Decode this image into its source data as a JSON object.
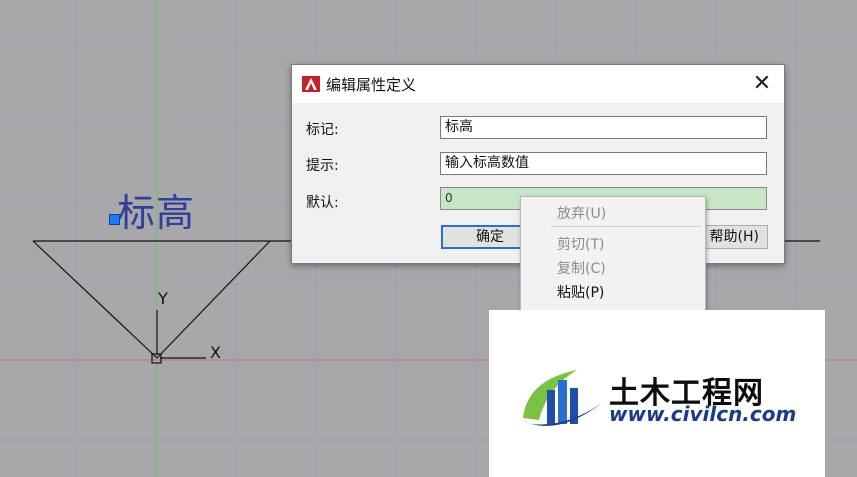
{
  "cad": {
    "text_label": "标高",
    "axis_y": "Y",
    "axis_x": "X"
  },
  "dialog": {
    "title": "编辑属性定义",
    "close_icon": "close-icon",
    "app_icon": "autocad-logo-icon",
    "fields": [
      {
        "label": "标记:",
        "value": "标高"
      },
      {
        "label": "提示:",
        "value": "输入标高数值"
      },
      {
        "label": "默认:",
        "value": "0"
      }
    ],
    "buttons": {
      "ok": "确定",
      "help": "帮助(H)"
    }
  },
  "context_menu": {
    "items": [
      {
        "label": "放弃(U)",
        "enabled": false
      },
      {
        "label": "剪切(T)",
        "enabled": false
      },
      {
        "label": "复制(C)",
        "enabled": false
      },
      {
        "label": "粘贴(P)",
        "enabled": true
      }
    ]
  },
  "watermark": {
    "title": "土木工程网",
    "url": "www.civilcn.com"
  },
  "colors": {
    "canvas_bg": "#a8a8aa",
    "grid": "#9496b4",
    "highlight_field": "#c6e6c6",
    "accent": "#2d6fd0"
  }
}
